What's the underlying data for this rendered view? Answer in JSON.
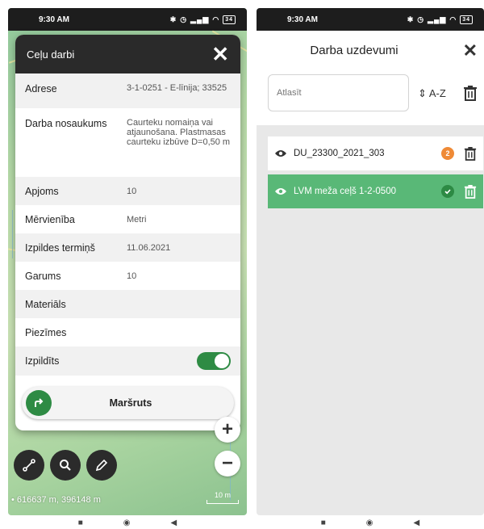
{
  "left": {
    "status": {
      "time": "9:30 AM",
      "battery": "34"
    },
    "modal": {
      "title": "Ceļu darbi",
      "close": "✕",
      "rows": [
        {
          "label": "Adrese",
          "value": "3-1-0251 - E-līnija; 33525"
        },
        {
          "label": "Darba nosaukums",
          "value": "Caurteku nomaiņa vai atjaunošana. Plastmasas caurteku izbūve D=0,50 m"
        },
        {
          "label": "Apjoms",
          "value": "10"
        },
        {
          "label": "Mērvienība",
          "value": "Metri"
        },
        {
          "label": "Izpildes termiņš",
          "value": "11.06.2021"
        },
        {
          "label": "Garums",
          "value": "10"
        },
        {
          "label": "Materiāls",
          "value": ""
        },
        {
          "label": "Piezīmes",
          "value": ""
        },
        {
          "label": "Izpildīts",
          "value": ""
        }
      ],
      "toggle_on": true,
      "route_label": "Maršruts"
    },
    "zoom_in": "+",
    "zoom_out": "−",
    "coords": "• 616637 m, 396148 m",
    "scale": "10 m",
    "colors": {
      "accent": "#2e8b44",
      "header": "#2a2a2a"
    }
  },
  "right": {
    "status": {
      "time": "9:30 AM",
      "battery": "34"
    },
    "title": "Darba uzdevumi",
    "close": "✕",
    "search_placeholder": "Atlasīt",
    "sort_label": "A-Z",
    "tasks": [
      {
        "name": "DU_23300_2021_303",
        "badge": "2",
        "status": "pending",
        "color": "#ef8a36"
      },
      {
        "name": "LVM meža ceļš 1-2-0500",
        "badge": "",
        "status": "done",
        "color": "#59b877"
      }
    ]
  }
}
